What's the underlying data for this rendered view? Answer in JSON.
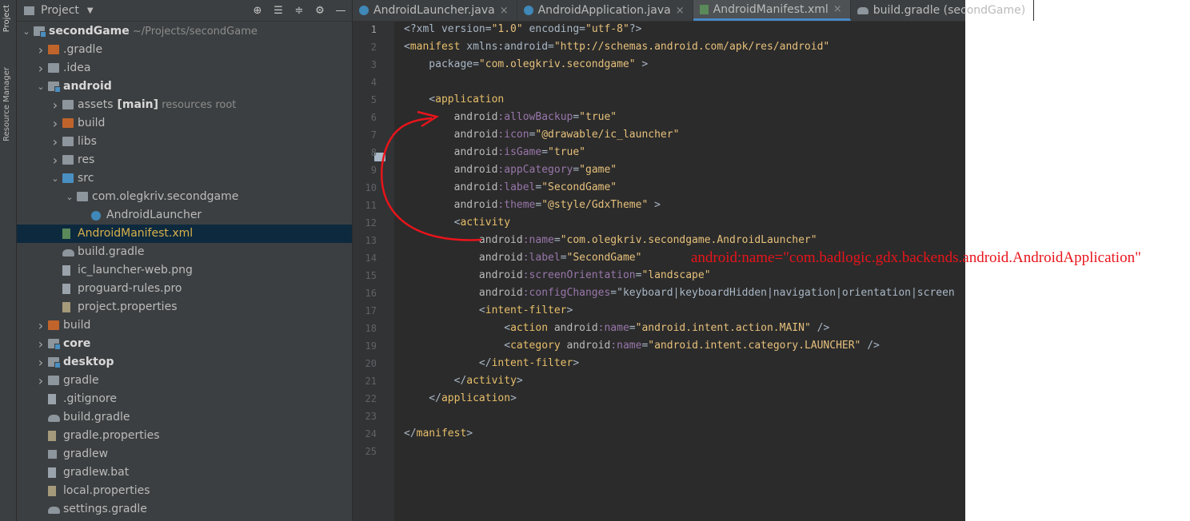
{
  "toolstrip": {
    "project_tab": "Project",
    "resource_manager_tab": "Resource Manager"
  },
  "project_panel": {
    "title": "Project",
    "tree": [
      {
        "label": "secondGame",
        "suffix": "~/Projects/secondGame",
        "bold": true,
        "expanded": true,
        "icon": "folder-module-icon"
      },
      {
        "label": ".gradle",
        "icon": "folder-excluded-icon",
        "expanded": false
      },
      {
        "label": ".idea",
        "icon": "folder-icon",
        "expanded": false
      },
      {
        "label": "android",
        "bold": true,
        "icon": "folder-module-icon",
        "expanded": true
      },
      {
        "label": "assets",
        "tag": "[main]",
        "suffix": "resources root",
        "icon": "folder-resources-icon",
        "expanded": false
      },
      {
        "label": "build",
        "icon": "folder-excluded-icon",
        "expanded": false
      },
      {
        "label": "libs",
        "icon": "folder-icon",
        "expanded": false
      },
      {
        "label": "res",
        "icon": "folder-res-icon",
        "expanded": false
      },
      {
        "label": "src",
        "icon": "folder-source-icon",
        "expanded": true
      },
      {
        "label": "com.olegkriv.secondgame",
        "icon": "package-icon",
        "expanded": true
      },
      {
        "label": "AndroidLauncher",
        "icon": "class-icon"
      },
      {
        "label": "AndroidManifest.xml",
        "icon": "xml-file-icon",
        "selected": true
      },
      {
        "label": "build.gradle",
        "icon": "gradle-file-icon"
      },
      {
        "label": "ic_launcher-web.png",
        "icon": "image-file-icon"
      },
      {
        "label": "proguard-rules.pro",
        "icon": "text-file-icon"
      },
      {
        "label": "project.properties",
        "icon": "properties-file-icon"
      },
      {
        "label": "build",
        "icon": "folder-excluded-icon",
        "expanded": false
      },
      {
        "label": "core",
        "bold": true,
        "icon": "folder-module-icon",
        "expanded": false
      },
      {
        "label": "desktop",
        "bold": true,
        "icon": "folder-module-icon",
        "expanded": false
      },
      {
        "label": "gradle",
        "icon": "folder-icon",
        "expanded": false
      },
      {
        "label": ".gitignore",
        "icon": "gitignore-file-icon"
      },
      {
        "label": "build.gradle",
        "icon": "gradle-file-icon"
      },
      {
        "label": "gradle.properties",
        "icon": "properties-file-icon"
      },
      {
        "label": "gradlew",
        "icon": "script-file-icon"
      },
      {
        "label": "gradlew.bat",
        "icon": "text-file-icon"
      },
      {
        "label": "local.properties",
        "icon": "properties-file-icon"
      },
      {
        "label": "settings.gradle",
        "icon": "gradle-file-icon"
      }
    ]
  },
  "editor": {
    "tabs": [
      {
        "label": "AndroidLauncher.java",
        "icon": "class-icon",
        "active": false
      },
      {
        "label": "AndroidApplication.java",
        "icon": "class-icon",
        "active": false
      },
      {
        "label": "AndroidManifest.xml",
        "icon": "xml-file-icon",
        "active": true
      },
      {
        "label": "build.gradle (secondGame)",
        "icon": "gradle-file-icon",
        "active": false
      }
    ],
    "line_numbers": [
      "1",
      "2",
      "3",
      "4",
      "5",
      "6",
      "7",
      "8",
      "9",
      "10",
      "11",
      "12",
      "13",
      "14",
      "15",
      "16",
      "17",
      "18",
      "19",
      "20",
      "21",
      "22",
      "23",
      "24",
      "25"
    ],
    "code_lines": [
      "<?xml version=\"1.0\" encoding=\"utf-8\"?>",
      "<manifest xmlns:android=\"http://schemas.android.com/apk/res/android\"",
      "    package=\"com.olegkriv.secondgame\" >",
      "",
      "    <application",
      "        android:allowBackup=\"true\"",
      "        android:icon=\"@drawable/ic_launcher\"",
      "        android:isGame=\"true\"",
      "        android:appCategory=\"game\"",
      "        android:label=\"SecondGame\"",
      "        android:theme=\"@style/GdxTheme\" >",
      "        <activity",
      "            android:name=\"com.olegkriv.secondgame.AndroidLauncher\"",
      "            android:label=\"SecondGame\"",
      "            android:screenOrientation=\"landscape\"",
      "            android:configChanges=\"keyboard|keyboardHidden|navigation|orientation|screen",
      "            <intent-filter>",
      "                <action android:name=\"android.intent.action.MAIN\" />",
      "                <category android:name=\"android.intent.category.LAUNCHER\" />",
      "            </intent-filter>",
      "        </activity>",
      "    </application>",
      "",
      "</manifest>",
      ""
    ]
  },
  "annotation": {
    "text": "android:name=\"com.badlogic.gdx.backends.android.AndroidApplication\"",
    "color": "#e8141b"
  }
}
